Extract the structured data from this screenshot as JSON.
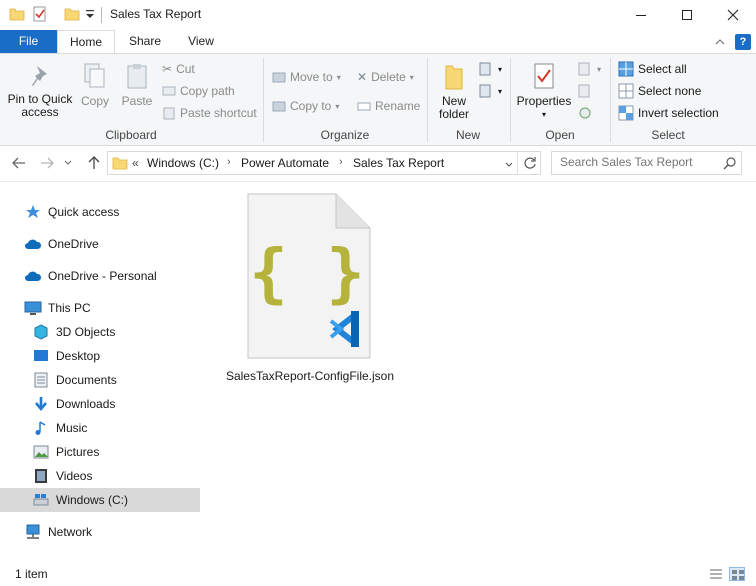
{
  "window": {
    "title": "Sales Tax Report"
  },
  "ribbon_tabs": {
    "file": "File",
    "home": "Home",
    "share": "Share",
    "view": "View"
  },
  "clipboard": {
    "pin": "Pin to Quick access",
    "copy": "Copy",
    "paste": "Paste",
    "cut": "Cut",
    "copy_path": "Copy path",
    "paste_shortcut": "Paste shortcut",
    "label": "Clipboard"
  },
  "organize": {
    "move_to": "Move to",
    "copy_to": "Copy to",
    "delete": "Delete",
    "rename": "Rename",
    "label": "Organize"
  },
  "new_group": {
    "new_folder_line1": "New",
    "new_folder_line2": "folder",
    "label": "New"
  },
  "open_group": {
    "properties": "Properties",
    "label": "Open"
  },
  "select_group": {
    "select_all": "Select all",
    "select_none": "Select none",
    "invert_selection": "Invert selection",
    "label": "Select"
  },
  "address": {
    "overflow": "«",
    "crumbs": [
      "Windows (C:)",
      "Power Automate",
      "Sales Tax Report"
    ]
  },
  "search": {
    "placeholder": "Search Sales Tax Report"
  },
  "nav": {
    "quick_access": "Quick access",
    "onedrive": "OneDrive",
    "onedrive_personal": "OneDrive - Personal",
    "this_pc": "This PC",
    "objects3d": "3D Objects",
    "desktop": "Desktop",
    "documents": "Documents",
    "downloads": "Downloads",
    "music": "Music",
    "pictures": "Pictures",
    "videos": "Videos",
    "windows_c": "Windows (C:)",
    "network": "Network"
  },
  "files": [
    {
      "name": "SalesTaxReport-ConfigFile.json",
      "icon": "json-file-icon"
    }
  ],
  "status": {
    "count": "1 item"
  },
  "colors": {
    "accent": "#1a6dc6",
    "selected_nav": "#d9d9d9",
    "json_brace": "#b5b33b",
    "vscode_blue": "#1f84d8"
  }
}
